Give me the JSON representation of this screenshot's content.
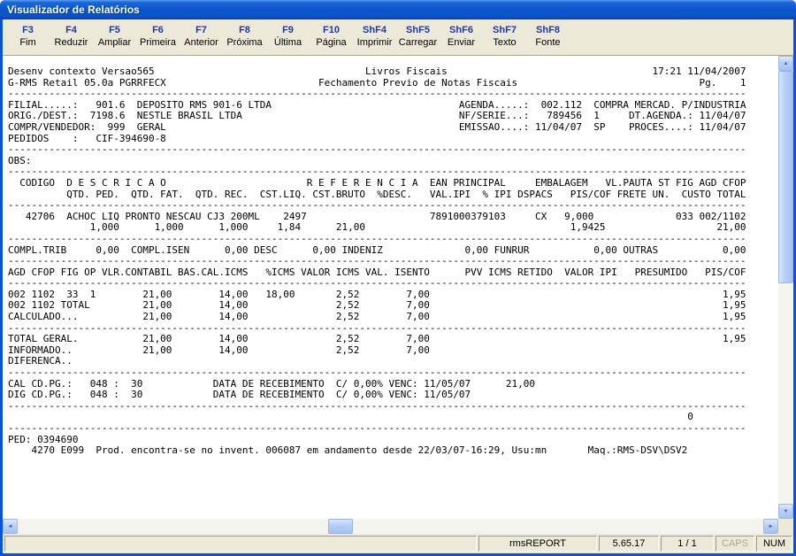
{
  "window": {
    "title": "Visualizador de Relatórios"
  },
  "toolbar": {
    "items": [
      {
        "key": "F3",
        "label": "Fim"
      },
      {
        "key": "F4",
        "label": "Reduzir"
      },
      {
        "key": "F5",
        "label": "Ampliar"
      },
      {
        "key": "F6",
        "label": "Primeira"
      },
      {
        "key": "F7",
        "label": "Anterior"
      },
      {
        "key": "F8",
        "label": "Próxima"
      },
      {
        "key": "F9",
        "label": "Última"
      },
      {
        "key": "F10",
        "label": "Página"
      },
      {
        "key": "ShF4",
        "label": "Imprimir"
      },
      {
        "key": "ShF5",
        "label": "Carregar"
      },
      {
        "key": "ShF6",
        "label": "Enviar"
      },
      {
        "key": "ShF7",
        "label": "Texto"
      },
      {
        "key": "ShF8",
        "label": "Fonte"
      }
    ]
  },
  "report": {
    "lines": [
      "Desenv contexto Versao565                                    Livros Fiscais                                   17:21 11/04/2007",
      "G-RMS Retail 05.0a PGRRFECX                          Fechamento Previo de Notas Fiscais                               Pg.    1",
      "------------------------------------------------------------------------------------------------------------------------------",
      "FILIAL.....:   901.6  DEPOSITO RMS 901-6 LTDA                                AGENDA.....:  002.112  COMPRA MERCAD. P/INDUSTRIA",
      "ORIG./DEST.:  7198.6  NESTLE BRASIL LTDA                                     NF/SERIE...:   789456  1     DT.AGENDA.: 11/04/07",
      "COMPR/VENDEDOR:  999  GERAL                                                  EMISSAO....: 11/04/07  SP    PROCES....: 11/04/07",
      "PEDIDOS    :   CIF-394690-8",
      "------------------------------------------------------------------------------------------------------------------------------",
      "OBS:",
      "------------------------------------------------------------------------------------------------------------------------------",
      "  CODIGO  D E S C R I C A O                        R E F E R E N C I A  EAN PRINCIPAL     EMBALAGEM   VL.PAUTA ST FIG AGD CFOP",
      "          QTD. PED.  QTD. FAT.  QTD. REC.  CST.LIQ. CST.BRUTO  %DESC.   VAL.IPI  % IPI DSPACS   PIS/COF FRETE UN.  CUSTO TOTAL",
      "------------------------------------------------------------------------------------------------------------------------------",
      "   42706  ACHOC LIQ PRONTO NESCAU CJ3 200ML    2497                     7891000379103     CX   9,000              033 002/1102",
      "              1,000      1,000      1,000     1,84      21,00                                   1,9425                   21,00",
      "------------------------------------------------------------------------------------------------------------------------------",
      "COMPL.TRIB     0,00  COMPL.ISEN      0,00 DESC      0,00 INDENIZ              0,00 FUNRUR           0,00 OUTRAS           0,00",
      "------------------------------------------------------------------------------------------------------------------------------",
      "AGD CFOP FIG OP VLR.CONTABIL BAS.CAL.ICMS   %ICMS VALOR ICMS VAL. ISENTO      PVV ICMS RETIDO  VALOR IPI   PRESUMIDO   PIS/COF",
      "------------------------------------------------------------------------------------------------------------------------------",
      "002 1102  33  1        21,00        14,00   18,00       2,52        7,00                                                  1,95",
      "002 1102 TOTAL         21,00        14,00               2,52        7,00                                                  1,95",
      "CALCULADO...           21,00        14,00               2,52        7,00                                                  1,95",
      "------------------------------------------------------------------------------------------------------------------------------",
      "TOTAL GERAL.           21,00        14,00               2,52        7,00                                                  1,95",
      "INFORMADO..            21,00        14,00               2,52        7,00",
      "DIFERENCA..",
      "------------------------------------------------------------------------------------------------------------------------------",
      "CAL CD.PG.:   048 :  30            DATA DE RECEBIMENTO  C/ 0,00% VENC: 11/05/07      21,00",
      "DIG CD.PG.:   048 :  30            DATA DE RECEBIMENTO  C/ 0,00% VENC: 11/05/07",
      "------------------------------------------------------------------------------------------------------------------------------",
      "                                                                                                                    0",
      "------------------------------------------------------------------------------------------------------------------------------",
      "PED: 0394690",
      "    4270 E099  Prod. encontra-se no invent. 006087 em andamento desde 22/03/07-16:29, Usu:mn       Maq.:RMS-DSV\\DSV2"
    ]
  },
  "statusbar": {
    "app": "rmsREPORT",
    "version": "5.65.17",
    "page": "1 / 1",
    "caps": "CAPS",
    "num": "NUM"
  },
  "icons": {
    "up": "▲",
    "down": "▼",
    "left": "◄",
    "right": "►"
  },
  "colors": {
    "window_frame": "#0853DD",
    "titlebar_blue": "#0C54CC",
    "toolbar_bg": "#ECE9D8",
    "key_blue": "#2238A4",
    "caps_disabled": "#A8A594",
    "content_bg": "#FFFFFF"
  }
}
